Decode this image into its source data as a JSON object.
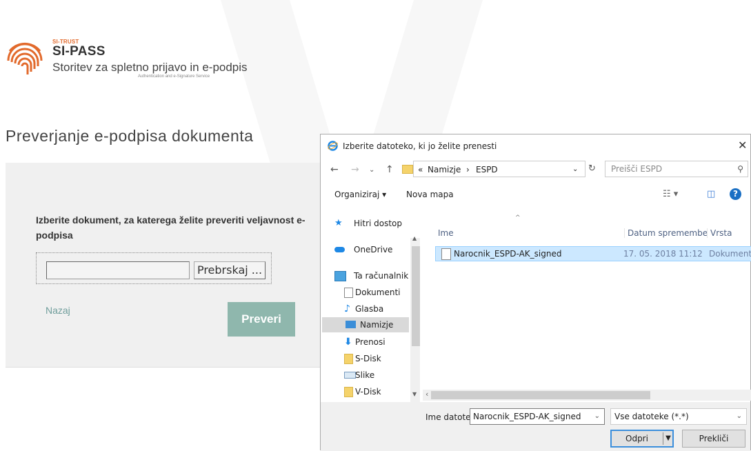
{
  "header": {
    "brand_small": "SI-TRUST",
    "brand": "SI-PASS",
    "subtitle": "Storitev za spletno prijavo in e-podpis",
    "tagline": "Authentication and e-Signature Service"
  },
  "page": {
    "title": "Preverjanje e-podpisa dokumenta",
    "instruction": "Izberite dokument, za katerega želite preveriti veljavnost e-podpisa",
    "file_value": "",
    "browse_label": "Prebrskaj ...",
    "back_label": "Nazaj",
    "check_label": "Preveri"
  },
  "dialog": {
    "title": "Izberite datoteko, ki jo želite prenesti",
    "breadcrumb": {
      "prefix": "«",
      "parent": "Namizje",
      "sep": "›",
      "current": "ESPD"
    },
    "search_placeholder": "Preišči ESPD",
    "toolbar": {
      "organize": "Organiziraj ▾",
      "new_folder": "Nova mapa"
    },
    "nav": [
      {
        "label": "Hitri dostop",
        "icon": "star-icon"
      },
      {
        "label": "OneDrive",
        "icon": "cloud-icon"
      },
      {
        "label": "Ta računalnik",
        "icon": "computer-icon"
      },
      {
        "label": "Dokumenti",
        "icon": "documents-icon"
      },
      {
        "label": "Glasba",
        "icon": "music-icon"
      },
      {
        "label": "Namizje",
        "icon": "desktop-icon"
      },
      {
        "label": "Prenosi",
        "icon": "download-icon"
      },
      {
        "label": "S-Disk",
        "icon": "folder-icon"
      },
      {
        "label": "Slike",
        "icon": "pictures-icon"
      },
      {
        "label": "V-Disk",
        "icon": "folder-icon"
      }
    ],
    "columns": {
      "name": "Ime",
      "date": "Datum spremembe",
      "type": "Vrsta"
    },
    "files": [
      {
        "name": "Narocnik_ESPD-AK_signed",
        "date": "17. 05. 2018 11:12",
        "type": "Dokument"
      }
    ],
    "filename_label": "Ime datoteke:",
    "filename_value": "Narocnik_ESPD-AK_signed",
    "filetype": "Vse datoteke (*.*)",
    "open_label": "Odpri",
    "cancel_label": "Prekliči"
  },
  "colors": {
    "accent": "#8fb7ad",
    "link": "#6f9d9b",
    "logo": "#e26a2c",
    "selection": "#cce8ff"
  }
}
